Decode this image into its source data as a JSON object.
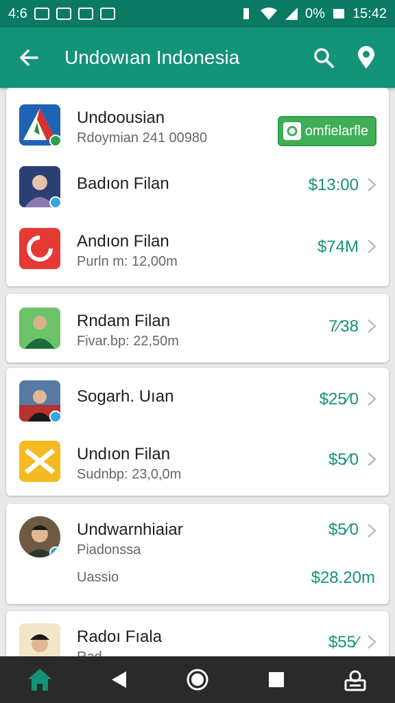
{
  "status_bar": {
    "time": "15:42",
    "left_text": "4:6",
    "battery_text": "0%"
  },
  "app_bar": {
    "title": "Undowıan Indonesia",
    "back_icon": "back-arrow-icon",
    "search_icon": "search-icon",
    "location_icon": "location-pin-icon"
  },
  "cards": [
    {
      "rows": [
        {
          "name": "Undoousian",
          "sub": "Rdoymian 241 00980",
          "cta": "omfielarfle"
        },
        {
          "name": "Badıon Filan",
          "sub": "",
          "price": "$13:00"
        },
        {
          "name": "Andıon Filan",
          "sub": "Purln m: 12,00m",
          "price": "$74M"
        }
      ]
    },
    {
      "rows": [
        {
          "name": "Rndam Filan",
          "sub": "Fivar.bp: 22,50m",
          "price": "7⁄38"
        }
      ]
    },
    {
      "rows": [
        {
          "name": "Sogarh. Uıan",
          "sub": "",
          "price": "$25⁄0"
        },
        {
          "name": "Undıon Filan",
          "sub": "Sudnbp: 23,0,0m",
          "price": "$5⁄0"
        }
      ]
    },
    {
      "rows": [
        {
          "name": "Undwarnhiaiar",
          "sub": "Piadonssa",
          "price": "$5⁄0"
        },
        {
          "name": "",
          "sub": "Uassio",
          "price": "$28.20m"
        }
      ]
    },
    {
      "rows": [
        {
          "name": "Radoı Fıala",
          "sub": "Rad...",
          "price": "$55⁄"
        }
      ]
    }
  ],
  "colors": {
    "primary": "#139377",
    "primary_dark": "#0b7a62",
    "accent_green": "#3fae57"
  }
}
